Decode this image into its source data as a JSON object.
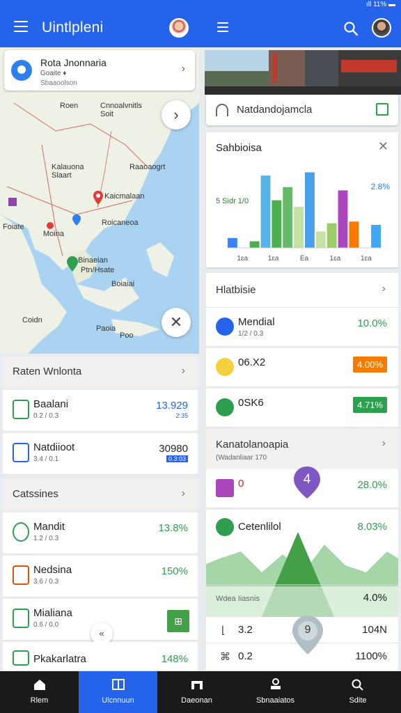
{
  "status": {
    "text": "ıll 11% ▬"
  },
  "app": {
    "title": "Uintlpleni"
  },
  "location_card": {
    "title": "Rota Jnonnaria",
    "line1": "Goaite ♦",
    "line2": "Sbaaoolson"
  },
  "map": {
    "labels": [
      "Roen",
      "Cnnoalvnitls\nSoit",
      "Kalauona\nSlaart",
      "Raaoaogrt",
      "Kaicmalaan",
      "Foiate",
      "Roicaneoa",
      "Moina",
      "Binaeian",
      "Ptn/Hsate",
      "Boiaiai",
      "Coidn",
      "Paoia",
      "Poo"
    ]
  },
  "left_section1": {
    "title": "Raten Wnlonta"
  },
  "left_rows1": [
    {
      "name": "Baalani",
      "sub": "0.2 / 0.3",
      "value": "13.929",
      "sub_value": "2:35"
    },
    {
      "name": "Natdiioot",
      "sub": "3.4 / 0.1",
      "value": "30980",
      "sub_value": "0.3:03"
    }
  ],
  "left_section2": {
    "title": "Catssines"
  },
  "left_rows2": [
    {
      "name": "Mandit",
      "sub": "1.2 / 0.3",
      "value": "13.8%"
    },
    {
      "name": "Nedsina",
      "sub": "3.6 / 0.3",
      "value": "150%"
    },
    {
      "name": "Mialiana",
      "sub": "0.6 / 0.0",
      "value": ""
    },
    {
      "name": "Pkakarlatra",
      "sub": "",
      "value": "148%"
    }
  ],
  "search_card": {
    "text": "Natdandojamcla"
  },
  "chart_card": {
    "title": "Sahbioisa"
  },
  "chart_data": {
    "type": "bar",
    "title": "Sahbioisa",
    "categories": [
      "1ɛa",
      "1ɛa",
      "1ɛa",
      "1ɛa",
      "1ɛa",
      "1ɛa",
      "1ɛa",
      "1ɛa",
      "1ɛa",
      "1ɛa",
      "1ɛa",
      "1ɛa",
      "1ɛa",
      "1ɛa"
    ],
    "values": [
      12,
      0,
      8,
      88,
      58,
      74,
      50,
      92,
      20,
      30,
      70,
      32,
      30,
      28
    ],
    "colors": [
      "#3b82f6",
      "#ffffff",
      "#4caf50",
      "#58b4e8",
      "#4caf50",
      "#66bb6a",
      "#c5e1a5",
      "#4aa0e8",
      "#c5e1a5",
      "#9ccc65",
      "#ab47bc",
      "#f57c00",
      "#ffffff",
      "#42a5f5"
    ],
    "ylim": [
      0,
      100
    ],
    "x_ticks": [
      "1ɛa",
      "1ɛa",
      "Ѐa",
      "1ɛa",
      "1ɛa"
    ],
    "annotations": [
      "5 Sidr 1/0",
      "2.8%"
    ]
  },
  "right_section1": {
    "title": "Hlatbisie"
  },
  "stats": [
    {
      "name": "Mendial",
      "sub": "1/2 / 0.3",
      "value": "10.0%",
      "color": "#2563eb"
    },
    {
      "name": "06.X2",
      "sub": "",
      "value": "4.00%",
      "color": "#f4b400",
      "badge_color": "#f57c00"
    },
    {
      "name": "0SK6",
      "sub": "",
      "value": "4.71%",
      "color": "#2e9e4f",
      "badge_color": "#2e9e4f"
    }
  ],
  "right_section2": {
    "title": "Kanatolanoapia",
    "sub": "(Wadanliaar 170"
  },
  "lower_stats": [
    {
      "name": "0",
      "value": "28.0%"
    },
    {
      "name": "Cetenlilol",
      "value": "8.03%"
    }
  ],
  "area_chart": {
    "label": "Wdea Iiasnis",
    "value": "4.0%"
  },
  "bottom_rows": [
    {
      "name": "3.2",
      "value": "104N"
    },
    {
      "name": "0.2",
      "value": "1100%"
    }
  ],
  "markers": {
    "purple": "4",
    "grey": "9"
  },
  "nav": [
    {
      "label": "Rlem"
    },
    {
      "label": "Ulcnnuun"
    },
    {
      "label": "Daeonan"
    },
    {
      "label": "Sbnaaiatos"
    },
    {
      "label": "Sdite"
    }
  ]
}
